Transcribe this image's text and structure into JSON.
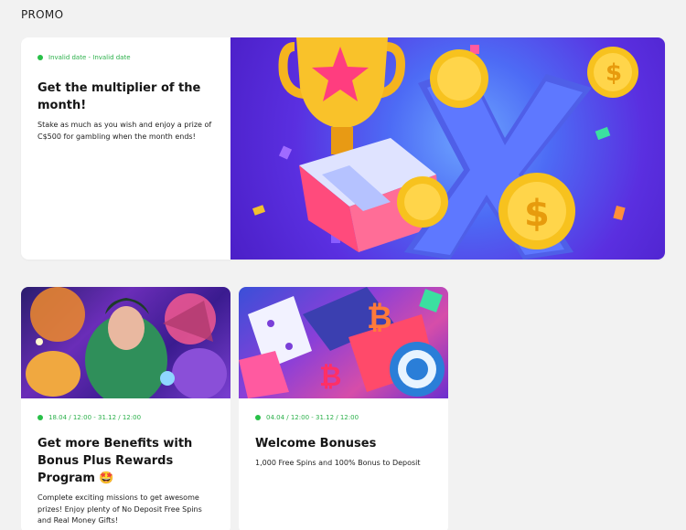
{
  "page": {
    "title": "PROMO"
  },
  "featured": {
    "date": "Invalid date - Invalid date",
    "title": "Get the multiplier of the month!",
    "description": "Stake as much as you wish and enjoy a prize of C$500 for gambling when the month ends!",
    "art_icons": [
      "trophy-icon",
      "star-icon",
      "coin-icon",
      "multiplier-x-icon",
      "gift-box-icon"
    ]
  },
  "cards": [
    {
      "date": "18.04 / 12:00 - 31.12 / 12:00",
      "title": "Get more Benefits with Bonus Plus Rewards Program 🤩",
      "description": "Complete exciting missions to get awesome prizes! Enjoy plenty of No Deposit Free Spins and Real Money Gifts!",
      "art_icons": [
        "fantasy-characters-illustration"
      ]
    },
    {
      "date": "04.04 / 12:00 - 31.12 / 12:00",
      "title": "Welcome Bonuses",
      "description": "1,000 Free Spins and 100% Bonus to Deposit",
      "art_icons": [
        "dice-icon",
        "casino-chip-icon",
        "bitcoin-icon"
      ]
    }
  ],
  "colors": {
    "background": "#f2f2f2",
    "card": "#ffffff",
    "status_dot": "#28c048",
    "date_text": "#2bb04a"
  }
}
